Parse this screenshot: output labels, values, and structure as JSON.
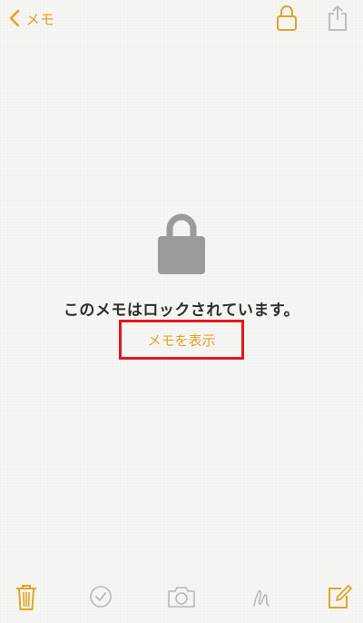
{
  "nav": {
    "back_label": "メモ",
    "lock_icon": "lock-open-icon",
    "share_icon": "share-icon"
  },
  "main": {
    "locked_message": "このメモはロックされています。",
    "show_note_label": "メモを表示",
    "lock_icon": "lock-closed-icon"
  },
  "toolbar": {
    "items": [
      {
        "icon": "trash-icon",
        "enabled": true
      },
      {
        "icon": "checklist-icon",
        "enabled": false
      },
      {
        "icon": "camera-icon",
        "enabled": false
      },
      {
        "icon": "sketch-icon",
        "enabled": false
      },
      {
        "icon": "compose-icon",
        "enabled": true
      }
    ]
  },
  "colors": {
    "accent": "#e0a526",
    "highlight_box": "#e5161c",
    "disabled": "#b8b8b8",
    "lock_gray": "#9b9b9b",
    "background": "#f6f6f4"
  }
}
